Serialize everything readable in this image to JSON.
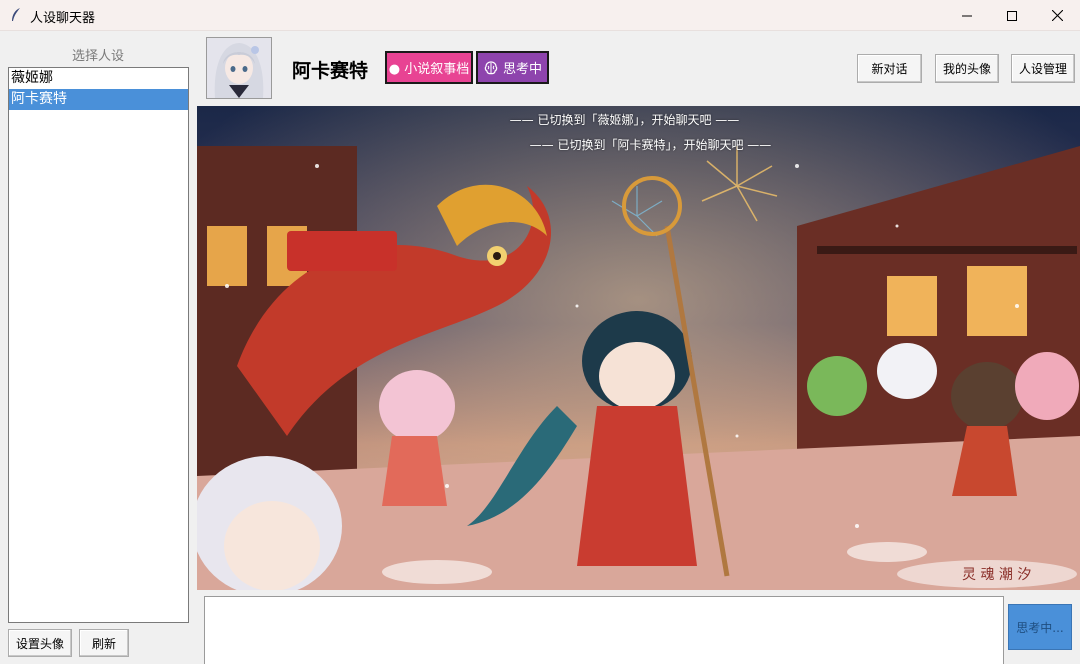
{
  "window": {
    "title": "人设聊天器"
  },
  "sidebar": {
    "title": "选择人设",
    "personas": [
      {
        "label": "薇姬娜",
        "selected": false
      },
      {
        "label": "阿卡赛特",
        "selected": true
      }
    ],
    "set_avatar_label": "设置头像",
    "refresh_label": "刷新"
  },
  "header": {
    "character_name": "阿卡赛特",
    "novel_mode_label": "● 小说叙事档",
    "thinking_label": "思考中",
    "new_chat_label": "新对话",
    "my_avatar_label": "我的头像",
    "persona_manage_label": "人设管理"
  },
  "chat": {
    "messages": [
      "—— 已切换到「薇姬娜」，开始聊天吧 ——",
      "—— 已切换到「阿卡赛特」，开始聊天吧 ——"
    ],
    "watermark": "灵 魂 潮 汐"
  },
  "input": {
    "value": "",
    "send_label": "思考中..."
  },
  "colors": {
    "selection": "#4a90d9",
    "novel_badge": "#e84393",
    "thinking_badge": "#8e44ad",
    "send_button": "#4a90d9"
  }
}
